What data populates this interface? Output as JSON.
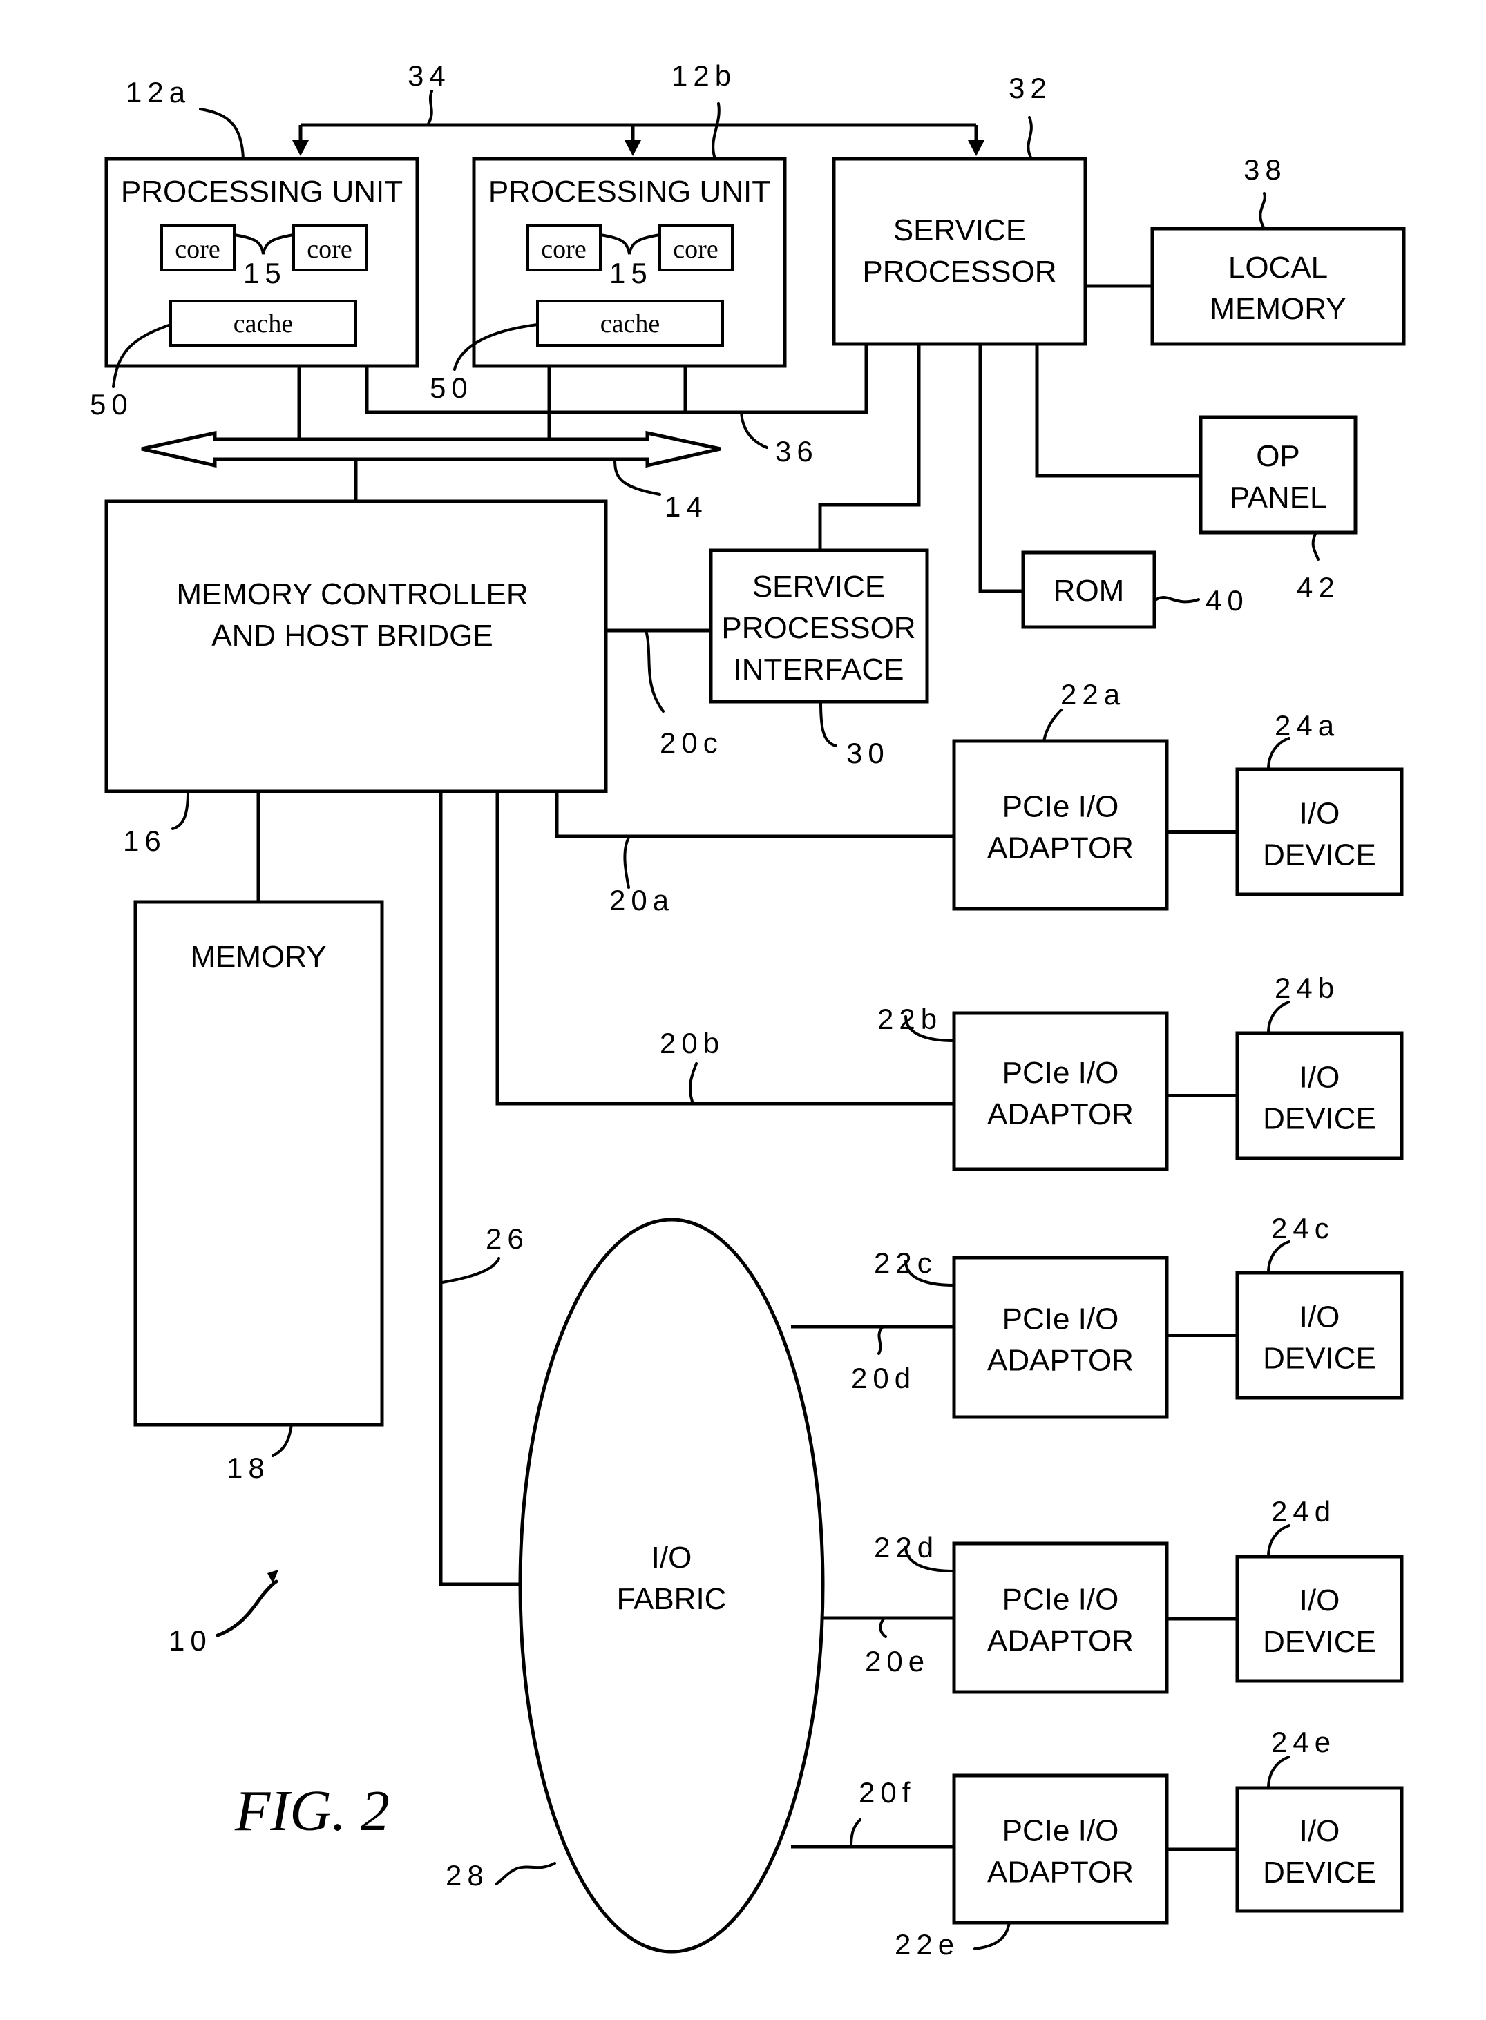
{
  "figure": {
    "caption": "FIG. 2",
    "system_ref": "10"
  },
  "blocks": {
    "pu_a": {
      "line1": "PROCESSING UNIT",
      "core1": "core",
      "core2": "core",
      "cores_ref": "15",
      "cache": "cache",
      "cache_ref": "50",
      "ref": "12a"
    },
    "pu_b": {
      "line1": "PROCESSING UNIT",
      "core1": "core",
      "core2": "core",
      "cores_ref": "15",
      "cache": "cache",
      "cache_ref": "50",
      "ref": "12b"
    },
    "service_processor": {
      "line1": "SERVICE",
      "line2": "PROCESSOR",
      "ref": "32"
    },
    "local_memory": {
      "line1": "LOCAL",
      "line2": "MEMORY",
      "ref": "38"
    },
    "op_panel": {
      "line1": "OP",
      "line2": "PANEL",
      "ref": "42"
    },
    "rom": {
      "line1": "ROM",
      "ref": "40"
    },
    "sp_interface": {
      "line1": "SERVICE",
      "line2": "PROCESSOR",
      "line3": "INTERFACE",
      "ref": "30"
    },
    "mem_controller": {
      "line1": "MEMORY CONTROLLER",
      "line2": "AND HOST BRIDGE",
      "ref": "16"
    },
    "memory": {
      "line1": "MEMORY",
      "ref": "18"
    },
    "io_fabric": {
      "line1": "I/O",
      "line2": "FABRIC",
      "ref": "28"
    },
    "adaptors": [
      {
        "line1": "PCIe I/O",
        "line2": "ADAPTOR",
        "ref": "22a"
      },
      {
        "line1": "PCIe I/O",
        "line2": "ADAPTOR",
        "ref": "22b"
      },
      {
        "line1": "PCIe I/O",
        "line2": "ADAPTOR",
        "ref": "22c"
      },
      {
        "line1": "PCIe I/O",
        "line2": "ADAPTOR",
        "ref": "22d"
      },
      {
        "line1": "PCIe I/O",
        "line2": "ADAPTOR",
        "ref": "22e"
      }
    ],
    "devices": [
      {
        "line1": "I/O",
        "line2": "DEVICE",
        "ref": "24a"
      },
      {
        "line1": "I/O",
        "line2": "DEVICE",
        "ref": "24b"
      },
      {
        "line1": "I/O",
        "line2": "DEVICE",
        "ref": "24c"
      },
      {
        "line1": "I/O",
        "line2": "DEVICE",
        "ref": "24d"
      },
      {
        "line1": "I/O",
        "line2": "DEVICE",
        "ref": "24e"
      }
    ]
  },
  "links": {
    "sp_bus": "34",
    "jtag_bus": "36",
    "system_bus": "14",
    "link_20a": "20a",
    "link_20b": "20b",
    "link_20c": "20c",
    "link_20d": "20d",
    "link_20e": "20e",
    "link_20f": "20f",
    "fabric_link": "26"
  }
}
